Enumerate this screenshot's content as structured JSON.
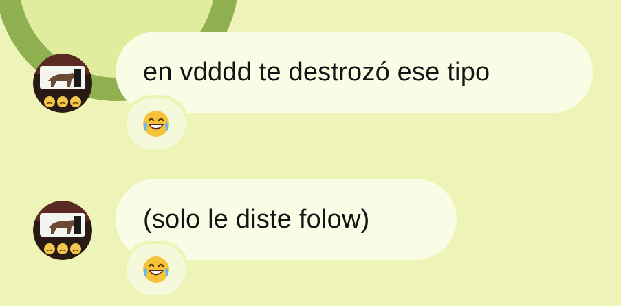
{
  "chat": {
    "messages": [
      {
        "text": "en vdddd te destrozó ese tipo",
        "reaction": "joy-emoji",
        "avatar_emojis": [
          "persevere",
          "persevere",
          "persevere"
        ]
      },
      {
        "text": "(solo le diste folow)",
        "reaction": "joy-emoji",
        "avatar_emojis": [
          "persevere",
          "persevere",
          "persevere"
        ]
      }
    ]
  },
  "colors": {
    "background": "#eef4b7",
    "bubble": "#fafde6",
    "reaction_bg": "#f5f9db",
    "wallpaper_circle": "#8fb050",
    "text": "#141414"
  }
}
